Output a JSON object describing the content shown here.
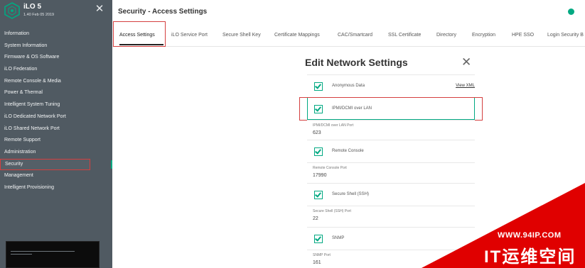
{
  "app": {
    "title": "iLO 5",
    "version": "1.40 Feb 05 2019"
  },
  "sidebar": {
    "items": [
      {
        "label": "Information"
      },
      {
        "label": "System Information"
      },
      {
        "label": "Firmware & OS Software"
      },
      {
        "label": "iLO Federation"
      },
      {
        "label": "Remote Console & Media"
      },
      {
        "label": "Power & Thermal"
      },
      {
        "label": "Intelligent System Tuning"
      },
      {
        "label": "iLO Dedicated Network Port"
      },
      {
        "label": "iLO Shared Network Port"
      },
      {
        "label": "Remote Support"
      },
      {
        "label": "Administration"
      },
      {
        "label": "Security"
      },
      {
        "label": "Management"
      },
      {
        "label": "Intelligent Provisioning"
      }
    ],
    "active_index": 11,
    "console_caption": "Remote Console thumbnail"
  },
  "header": {
    "title": "Security - Access Settings"
  },
  "tabs": [
    {
      "label": "Access Settings"
    },
    {
      "label": "iLO Service Port"
    },
    {
      "label": "Secure Shell Key"
    },
    {
      "label": "Certificate Mappings"
    },
    {
      "label": "CAC/Smartcard"
    },
    {
      "label": "SSL Certificate"
    },
    {
      "label": "Directory"
    },
    {
      "label": "Encryption"
    },
    {
      "label": "HPE SSO"
    },
    {
      "label": "Login Security B"
    }
  ],
  "dialog": {
    "title": "Edit Network Settings",
    "anonymous_data": {
      "label": "Anonymous Data",
      "checked": true,
      "link": "View XML"
    },
    "ipmi": {
      "label": "IPMI/DCMI over LAN",
      "checked": true
    },
    "ipmi_port": {
      "label": "IPMI/DCMI over LAN Port",
      "value": "623"
    },
    "remote_console": {
      "label": "Remote Console",
      "checked": true
    },
    "remote_console_port": {
      "label": "Remote Console Port",
      "value": "17990"
    },
    "ssh": {
      "label": "Secure Shell (SSH)",
      "checked": true
    },
    "ssh_port": {
      "label": "Secure Shell (SSH) Port",
      "value": "22"
    },
    "snmp": {
      "label": "SNMP",
      "checked": true
    },
    "snmp_port": {
      "label": "SNMP Port",
      "value": "161"
    }
  },
  "watermark": {
    "url": "WWW.94IP.COM",
    "text": "IT运维空间"
  },
  "colors": {
    "sidebar": "#505a62",
    "accent": "#01a982",
    "highlight": "#d43f3f",
    "watermark": "#e00000"
  }
}
